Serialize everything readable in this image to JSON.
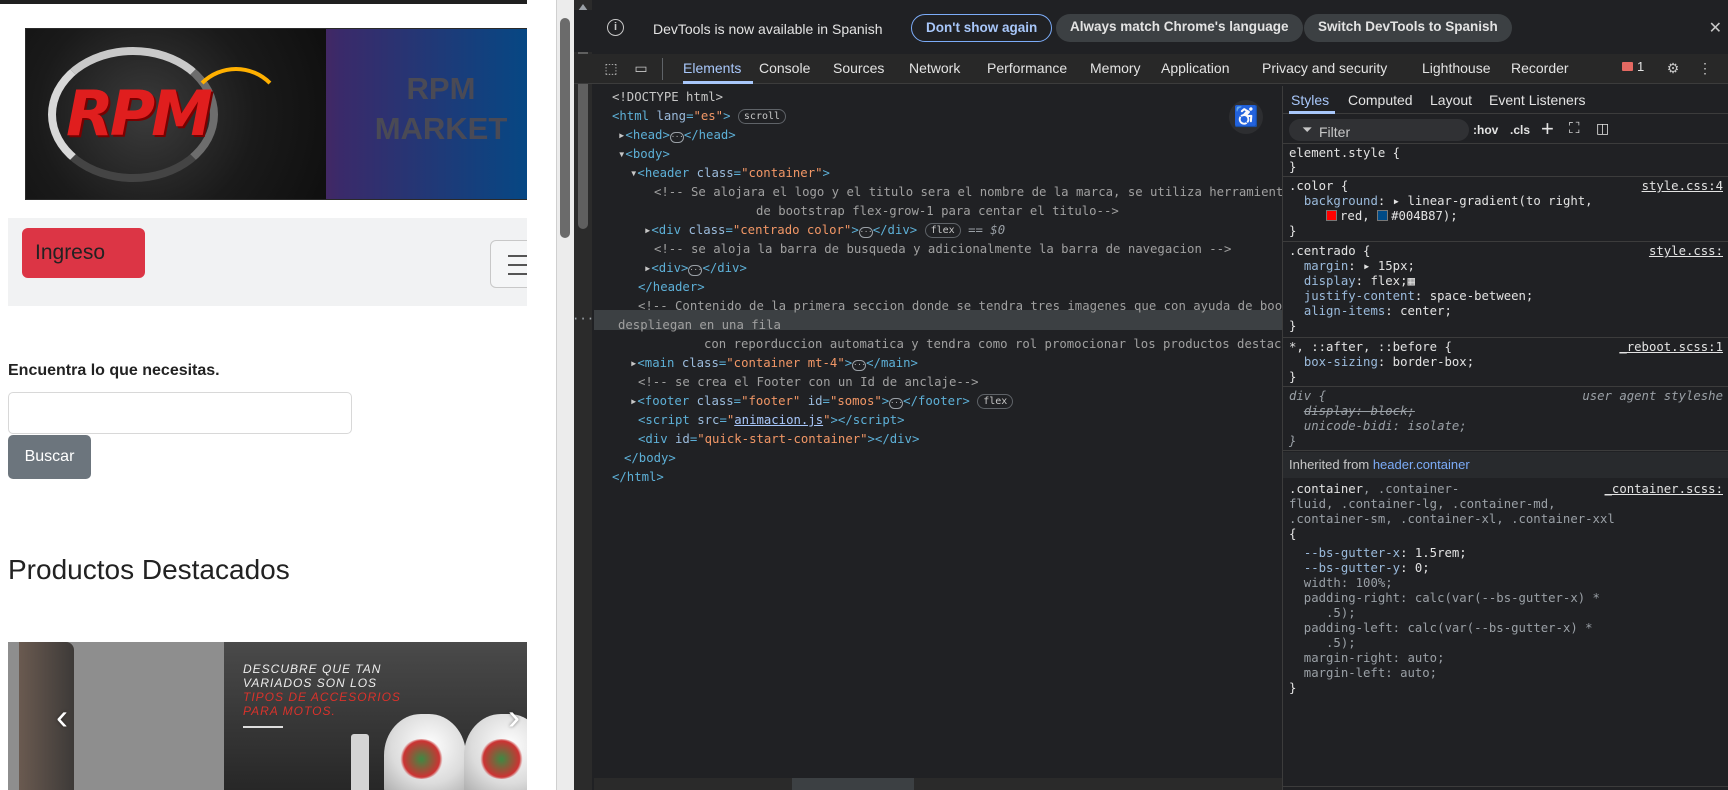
{
  "site": {
    "banner_title": "RPM\nMARKET",
    "login_button": "Ingreso",
    "search_label": "Encuentra lo que necesitas.",
    "search_placeholder": "",
    "search_button": "Buscar",
    "products_title": "Productos Destacados",
    "promo_line1": "DESCUBRE QUE TAN",
    "promo_line2": "VARIADOS SON LOS",
    "promo_line3": "TIPOS DE ACCESORIOS",
    "promo_line4": "PARA MOTOS.",
    "carousel_prev": "‹",
    "carousel_next": "›"
  },
  "devtools": {
    "infobar": {
      "text": "DevTools is now available in Spanish",
      "dont_show": "Don't show again",
      "match_language": "Always match Chrome's language",
      "switch": "Switch DevTools to Spanish",
      "close": "✕"
    },
    "tabs": [
      "Elements",
      "Console",
      "Sources",
      "Network",
      "Performance",
      "Memory",
      "Application",
      "Privacy and security",
      "Lighthouse",
      "Recorder"
    ],
    "issues_count": "1",
    "elements": {
      "doctype": "<!DOCTYPE html>",
      "html_open_tag": "html",
      "html_lang_attr": "lang",
      "html_lang_val": "\"es\"",
      "scroll_pill": "scroll",
      "head_tag": "head",
      "body_tag": "body",
      "header_tag": "header",
      "header_class_val": "\"container\"",
      "comment1a": "<!-- Se alojara el logo y el titulo sera el nombre de la marca, se utiliza herramienta",
      "comment1b": "de bootstrap flex-grow-1 para centar el titulo-->",
      "div_class_val": "\"centrado color\"",
      "flex_pill": "flex",
      "selected_marker": "== $0",
      "comment2": "<!-- se aloja la barra de busqueda y adicionalmente la barra de navegacion -->",
      "header_close": "</header>",
      "comment3a": "<!-- Contenido de la primera seccion donde se tendra tres imagenes que con ayuda de bootstrap se",
      "comment3b": "despliegan en una fila",
      "comment3c": "con reporduccion automatica y tendra como rol promocionar los productos destacados-->",
      "main_class_val": "\"container mt-4\"",
      "comment4": "<!-- se crea el Footer con un Id de anclaje-->",
      "footer_class_val": "\"footer\"",
      "footer_id_val": "\"somos\"",
      "script_src": "animacion.js",
      "quick_start_id": "\"quick-start-container\"",
      "body_close": "</body>",
      "html_close": "</html>"
    },
    "styles": {
      "tabs": [
        "Styles",
        "Computed",
        "Layout",
        "Event Listeners"
      ],
      "filter_placeholder": "Filter",
      "hov": ":hov",
      "cls": ".cls",
      "element_style": "element.style {",
      "color_rule": {
        "selector": ".color {",
        "source": "style.css:4",
        "prop": "background",
        "value_a": "linear-gradient(to right,",
        "value_b": "red,",
        "value_c": "#004B87);",
        "swatch_red": "#ff0000",
        "swatch_blue": "#004b87"
      },
      "centrado_rule": {
        "selector": ".centrado {",
        "source": "style.css:",
        "margin": "15px;",
        "display": "flex;",
        "justify": "space-between;",
        "align": "center;"
      },
      "reboot_rule": {
        "selector": "*, ::after, ::before {",
        "source": "_reboot.scss:1",
        "prop": "box-sizing",
        "value": "border-box;"
      },
      "ua_rule": {
        "selector": "div {",
        "source": "user agent styleshe",
        "display": "block;",
        "unicode": "isolate;"
      },
      "inherited_label": "Inherited from",
      "inherited_from": "header.container",
      "container_rule": {
        "selector_a": ".container",
        "selector_b": ", .container-",
        "selector_c": "fluid, .container-lg, .container-md,",
        "selector_d": ".container-sm, .container-xl, .container-xxl",
        "source": "_container.scss:",
        "gutter_x": "1.5rem;",
        "gutter_y": "0;",
        "width": "100%;",
        "padding_right": "calc(var(--bs-gutter-x) *",
        "padding_right2": ".5);",
        "padding_left": "calc(var(--bs-gutter-x) *",
        "padding_left2": ".5);",
        "margin_right": "auto;",
        "margin_left": "auto;"
      }
    }
  },
  "colors": {
    "danger": "#dc3545",
    "secondary": "#6c757d",
    "devtools_bg": "#202124",
    "accent": "#a8c7fa"
  }
}
